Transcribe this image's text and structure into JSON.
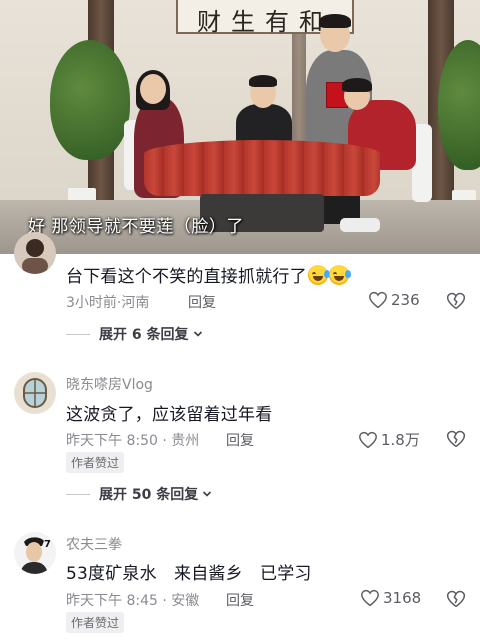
{
  "video": {
    "calligraphy": "财生有和",
    "subtitle": "好 那领导就不要莲（脸）了"
  },
  "comments": [
    {
      "username": "",
      "text": "台下看这个不笑的直接抓就行了",
      "emojis": [
        "laugh-cry-emoji",
        "laugh-cry-emoji"
      ],
      "time": "3小时前·河南",
      "reply_label": "回复",
      "likes": "236",
      "author_liked": false
    },
    {
      "username": "晓东嗏房Vlog",
      "text": "这波贪了，应该留着过年看",
      "time": "昨天下午 8:50 · 贵州",
      "reply_label": "回复",
      "likes": "1.8万",
      "author_liked": true,
      "author_badge": "作者赞过"
    },
    {
      "username": "农夫三拳",
      "text": "53度矿泉水　来自酱乡　已学习",
      "time": "昨天下午 8:45 · 安徽",
      "reply_label": "回复",
      "likes": "3168",
      "author_liked": true,
      "author_badge": "作者赞过",
      "avatar_number": "7"
    }
  ],
  "expand_replies": [
    {
      "label": "展开 6 条回复"
    },
    {
      "label": "展开 50 条回复"
    }
  ],
  "colors": {
    "text_primary": "#161823",
    "text_secondary": "#8a8b91",
    "subtitle": "#ffffff"
  }
}
